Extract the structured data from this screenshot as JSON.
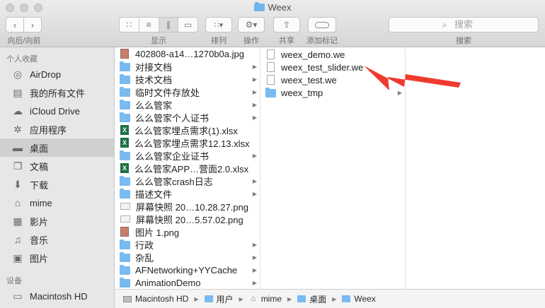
{
  "window": {
    "title": "Weex"
  },
  "toolbar": {
    "back_forward_label": "向后/向前",
    "view_label": "显示",
    "arrange_label": "排列",
    "action_label": "操作",
    "share_label": "共享",
    "tags_label": "添加标记",
    "search_label": "搜索",
    "search_placeholder": "搜索",
    "back_icon": "chevron-left-icon",
    "forward_icon": "chevron-right-icon"
  },
  "sidebar": {
    "favorites_header": "个人收藏",
    "devices_header": "设备",
    "favorites": [
      {
        "label": "AirDrop",
        "icon": "airdrop-icon"
      },
      {
        "label": "我的所有文件",
        "icon": "all-files-icon"
      },
      {
        "label": "iCloud Drive",
        "icon": "cloud-icon"
      },
      {
        "label": "应用程序",
        "icon": "applications-icon"
      },
      {
        "label": "桌面",
        "icon": "desktop-icon",
        "selected": true
      },
      {
        "label": "文稿",
        "icon": "documents-icon"
      },
      {
        "label": "下载",
        "icon": "download-icon"
      },
      {
        "label": "mime",
        "icon": "home-icon"
      },
      {
        "label": "影片",
        "icon": "movies-icon"
      },
      {
        "label": "音乐",
        "icon": "music-icon"
      },
      {
        "label": "图片",
        "icon": "pictures-icon"
      }
    ],
    "devices": [
      {
        "label": "Macintosh HD",
        "icon": "hard-drive-icon"
      }
    ]
  },
  "columns": {
    "desktop": [
      {
        "name": "402808-a14…1270b0a.jpg",
        "type": "img",
        "folder": false
      },
      {
        "name": "对接文档",
        "type": "folder",
        "folder": true
      },
      {
        "name": "技术文档",
        "type": "folder",
        "folder": true
      },
      {
        "name": "临时文件存放处",
        "type": "folder",
        "folder": true
      },
      {
        "name": "么么管家",
        "type": "folder",
        "folder": true
      },
      {
        "name": "么么管家个人证书",
        "type": "folder",
        "folder": true
      },
      {
        "name": "么么管家埋点需求(1).xlsx",
        "type": "xls",
        "folder": false
      },
      {
        "name": "么么管家埋点需求12.13.xlsx",
        "type": "xls",
        "folder": false
      },
      {
        "name": "么么管家企业证书",
        "type": "folder",
        "folder": true
      },
      {
        "name": "么么管家APP…营面2.0.xlsx",
        "type": "xls",
        "folder": false
      },
      {
        "name": "么么管家crash日志",
        "type": "folder",
        "folder": true
      },
      {
        "name": "描述文件",
        "type": "folder",
        "folder": true
      },
      {
        "name": "屏幕快照 20…10.28.27.png",
        "type": "png",
        "folder": false
      },
      {
        "name": "屏幕快照 20…5.57.02.png",
        "type": "png",
        "folder": false
      },
      {
        "name": "图片 1.png",
        "type": "img",
        "folder": false
      },
      {
        "name": "行政",
        "type": "folder",
        "folder": true
      },
      {
        "name": "杂乱",
        "type": "folder",
        "folder": true
      },
      {
        "name": "AFNetworking+YYCache",
        "type": "folder",
        "folder": true
      },
      {
        "name": "AnimationDemo",
        "type": "folder",
        "folder": true
      }
    ],
    "weex": [
      {
        "name": "weex_demo.we",
        "type": "doc",
        "folder": false
      },
      {
        "name": "weex_test_slider.we",
        "type": "doc",
        "folder": false
      },
      {
        "name": "weex_test.we",
        "type": "doc",
        "folder": false
      },
      {
        "name": "weex_tmp",
        "type": "folder",
        "folder": true
      }
    ]
  },
  "pathbar": [
    {
      "label": "Macintosh HD",
      "icon": "hard-drive-icon"
    },
    {
      "label": "用户",
      "icon": "folder-icon"
    },
    {
      "label": "mime",
      "icon": "home-icon"
    },
    {
      "label": "桌面",
      "icon": "folder-icon"
    },
    {
      "label": "Weex",
      "icon": "folder-icon"
    }
  ],
  "annotation": {
    "color": "#f03a2e"
  }
}
